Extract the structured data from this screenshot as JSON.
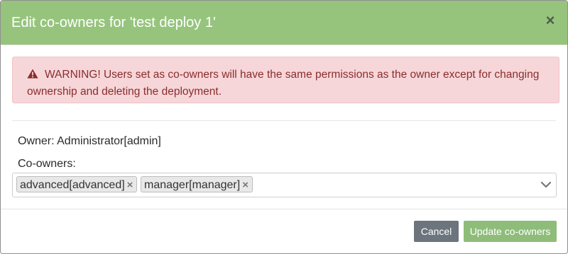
{
  "dialog": {
    "title": "Edit co-owners for 'test deploy 1'",
    "close_symbol": "×",
    "header_color": "#96c47d"
  },
  "warning": {
    "icon": "warning-triangle-icon",
    "text": "WARNING! Users set as co-owners will have the same permissions as the owner except for changing ownership and deleting the deployment.",
    "background": "#f6d6d9",
    "text_color": "#8b2d2d"
  },
  "owner": {
    "text": "Owner: Administrator[admin]"
  },
  "coowners": {
    "label": "Co-owners:",
    "tags": [
      {
        "label": "advanced[advanced]",
        "remove_symbol": "×"
      },
      {
        "label": "manager[manager]",
        "remove_symbol": "×"
      }
    ],
    "dropdown_icon": "chevron-down-icon"
  },
  "footer": {
    "cancel_label": "Cancel",
    "update_label": "Update co-owners",
    "cancel_color": "#6c757d",
    "update_color": "#8ebd7a"
  }
}
